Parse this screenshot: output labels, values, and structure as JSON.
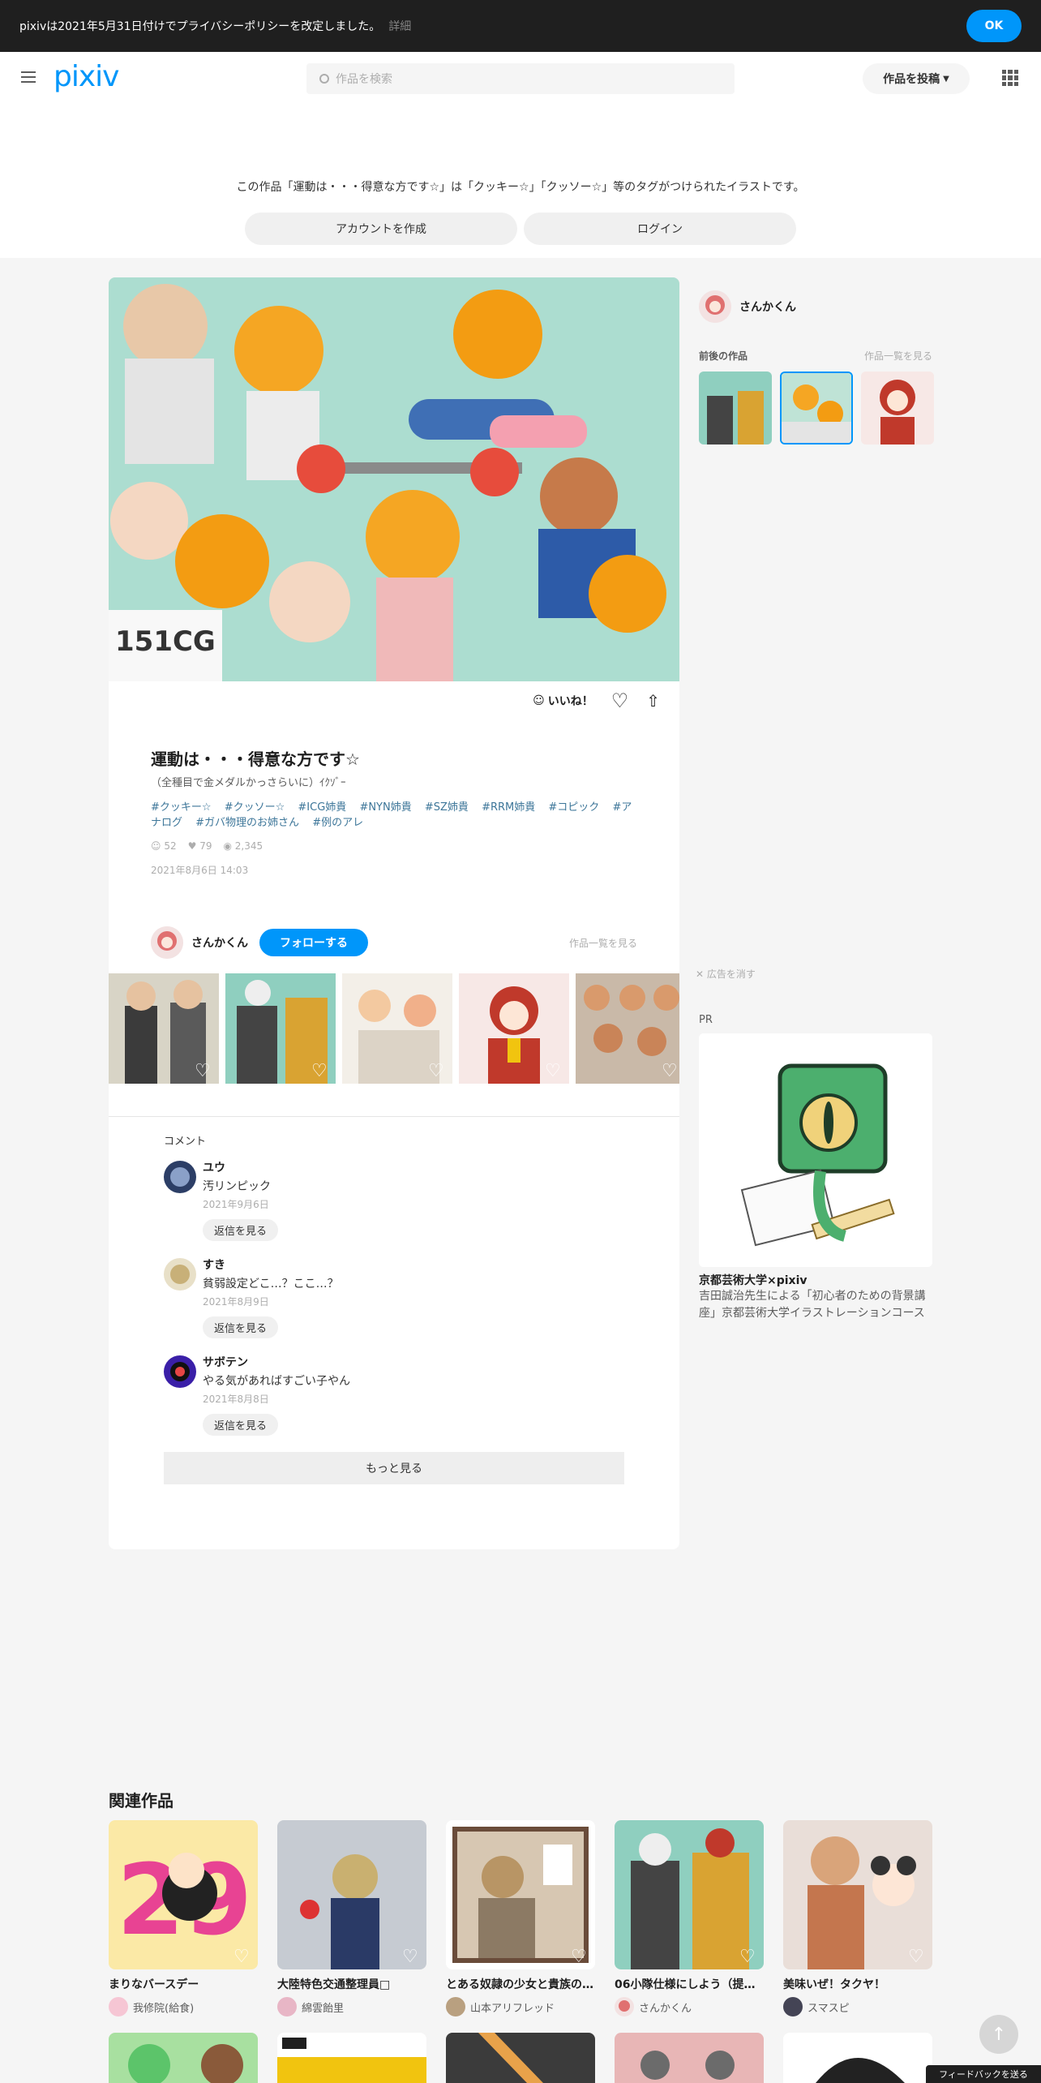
{
  "notice": {
    "text": "pixivは2021年5月31日付けでプライバシーポリシーを改定しました。",
    "detail": "詳細",
    "ok": "OK"
  },
  "header": {
    "logo": "pixiv",
    "search_placeholder": "作品を検索",
    "post_label": "作品を投稿"
  },
  "signup": {
    "text": "この作品「運動は・・・得意な方です☆」は「クッキー☆」「クッソー☆」等のタグがつけられたイラストです。",
    "create_account": "アカウントを作成",
    "login": "ログイン"
  },
  "artwork": {
    "like_label": "いいね！",
    "title": "運動は・・・得意な方です☆",
    "caption": "（全種目で金メダルかっさらいに）ｲｸｿﾞｰ",
    "tags": [
      "#クッキー☆",
      "#クッソー☆",
      "#ICG姉貴",
      "#NYN姉貴",
      "#SZ姉貴",
      "#RRM姉貴",
      "#コピック",
      "#アナログ",
      "#ガバ物理のお姉さん",
      "#例のアレ"
    ],
    "stats": {
      "likes": "52",
      "bookmarks": "79",
      "views": "2,345"
    },
    "date": "2021年8月6日 14:03"
  },
  "author": {
    "name": "さんかくん",
    "follow": "フォローする",
    "see_all": "作品一覧を見る"
  },
  "comments": {
    "heading": "コメント",
    "items": [
      {
        "name": "ユウ",
        "text": "汚リンピック",
        "date": "2021年9月6日",
        "reply": "返信を見る"
      },
      {
        "name": "すき",
        "text": "貧弱設定どこ…？ここ…？",
        "date": "2021年8月9日",
        "reply": "返信を見る"
      },
      {
        "name": "サボテン",
        "text": "やる気があればすごい子やん",
        "date": "2021年8月8日",
        "reply": "返信を見る"
      }
    ],
    "more": "もっと見る"
  },
  "sidebar": {
    "author_name": "さんかくん",
    "nearby_label": "前後の作品",
    "see_all": "作品一覧を見る",
    "hide_ad": "広告を消す",
    "pr": "PR",
    "ad_title": "京都芸術大学×pixiv",
    "ad_desc": "吉田誠治先生による「初心者のための背景講座」京都芸術大学イラストレーションコース"
  },
  "related": {
    "heading": "関連作品",
    "items": [
      {
        "title": "まりなバースデー",
        "user": "我修院(給食)"
      },
      {
        "title": "大陸特色交通整理員□",
        "user": "綿雲飴里"
      },
      {
        "title": "とある奴隷の少女と貴族の…",
        "user": "山本アリフレッド"
      },
      {
        "title": "06小隊仕様にしよう（提案…",
        "user": "さんかくん"
      },
      {
        "title": "美味いぜ！タクヤ！",
        "user": "スマスピ"
      }
    ]
  },
  "feedback": "フィードバックを送る",
  "colors": {
    "accent": "#0096fa",
    "tag": "#3d7699"
  }
}
